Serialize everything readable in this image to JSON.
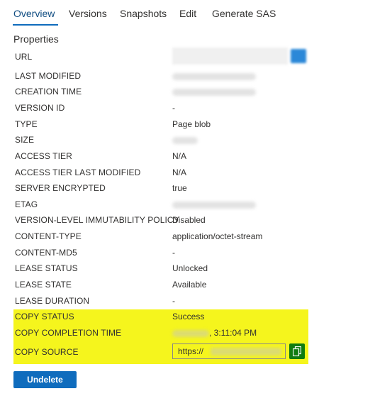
{
  "tabs": [
    {
      "label": "Overview",
      "active": true
    },
    {
      "label": "Versions"
    },
    {
      "label": "Snapshots"
    },
    {
      "label": "Edit"
    },
    {
      "label": "Generate SAS"
    }
  ],
  "section_title": "Properties",
  "properties": [
    {
      "label": "URL",
      "value": ""
    },
    {
      "label": "LAST MODIFIED",
      "value": ""
    },
    {
      "label": "CREATION TIME",
      "value": ""
    },
    {
      "label": "VERSION ID",
      "value": "-"
    },
    {
      "label": "TYPE",
      "value": "Page blob"
    },
    {
      "label": "SIZE",
      "value": ""
    },
    {
      "label": "ACCESS TIER",
      "value": "N/A"
    },
    {
      "label": "ACCESS TIER LAST MODIFIED",
      "value": "N/A"
    },
    {
      "label": "SERVER ENCRYPTED",
      "value": "true"
    },
    {
      "label": "ETAG",
      "value": ""
    },
    {
      "label": "VERSION-LEVEL IMMUTABILITY POLICY",
      "value": "Disabled"
    },
    {
      "label": "CONTENT-TYPE",
      "value": "application/octet-stream"
    },
    {
      "label": "CONTENT-MD5",
      "value": "-"
    },
    {
      "label": "LEASE STATUS",
      "value": "Unlocked"
    },
    {
      "label": "LEASE STATE",
      "value": "Available"
    },
    {
      "label": "LEASE DURATION",
      "value": "-"
    },
    {
      "label": "COPY STATUS",
      "value": "Success"
    },
    {
      "label": "COPY COMPLETION TIME",
      "value": ", 3:11:04 PM"
    },
    {
      "label": "COPY SOURCE",
      "value": "https://"
    }
  ],
  "undelete_label": "Undelete",
  "colors": {
    "accent": "#0f6cbd",
    "highlight": "#f5f51d",
    "copy_button": "#107c10"
  },
  "icons": {
    "copy": "copy-icon"
  }
}
